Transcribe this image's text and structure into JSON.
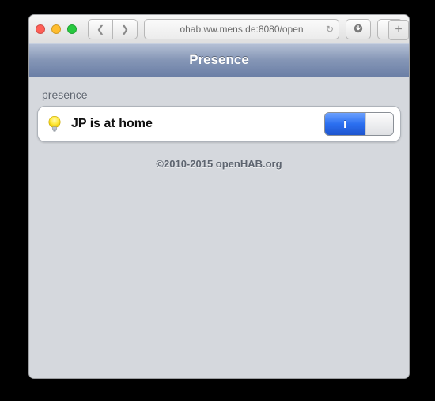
{
  "browser": {
    "url": "ohab.ww.mens.de:8080/open"
  },
  "page": {
    "title": "Presence",
    "section_label": "presence",
    "row": {
      "label": "JP is at home",
      "switch_state": "on",
      "switch_on_glyph": "I"
    },
    "footer": "©2010-2015 openHAB.org"
  }
}
